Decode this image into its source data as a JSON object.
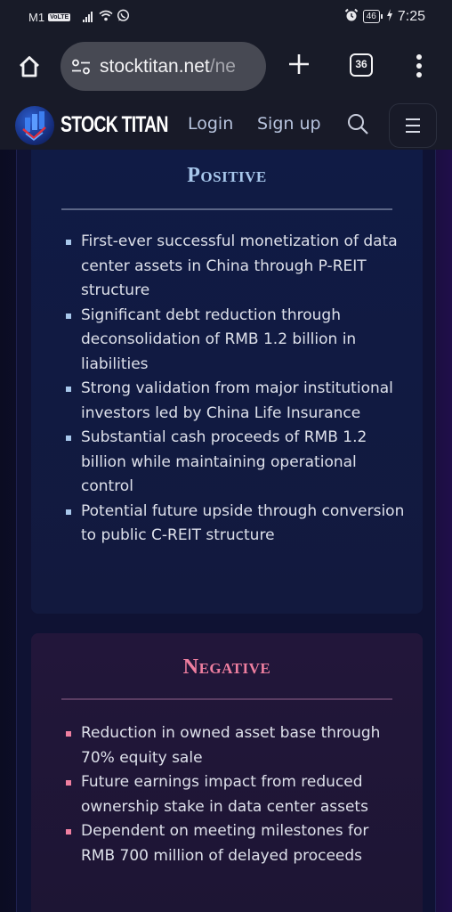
{
  "status_bar": {
    "carrier": "M1",
    "volte": "VoLTE",
    "battery": "46",
    "time": "7:25",
    "icons": [
      "signal-icon",
      "wifi-icon",
      "whatsapp-icon",
      "alarm-icon",
      "battery-icon",
      "charging-icon"
    ]
  },
  "browser": {
    "url_domain": "stocktitan.net",
    "url_path": "/ne",
    "tab_count": "36",
    "icons": [
      "home-icon",
      "site-settings-icon",
      "new-tab-icon",
      "tabs-icon",
      "more-icon"
    ]
  },
  "site_header": {
    "logo_text": "STOCK TITAN",
    "login_label": "Login",
    "signup_label": "Sign up",
    "icons": [
      "logo-icon",
      "search-icon",
      "menu-icon"
    ]
  },
  "positive": {
    "title": "Positive",
    "accent": "#a8c8ec",
    "items": [
      "First-ever successful monetization of data center assets in China through P-REIT structure",
      "Significant debt reduction through deconsolidation of RMB 1.2 billion in liabilities",
      "Strong validation from major institutional investors led by China Life Insurance",
      "Substantial cash proceeds of RMB 1.2 billion while maintaining operational control",
      "Potential future upside through conversion to public C-REIT structure"
    ]
  },
  "negative": {
    "title": "Negative",
    "accent": "#ef7fa0",
    "items": [
      "Reduction in owned asset base through 70% equity sale",
      "Future earnings impact from reduced ownership stake in data center assets",
      "Dependent on meeting milestones for RMB 700 million of delayed proceeds"
    ]
  }
}
